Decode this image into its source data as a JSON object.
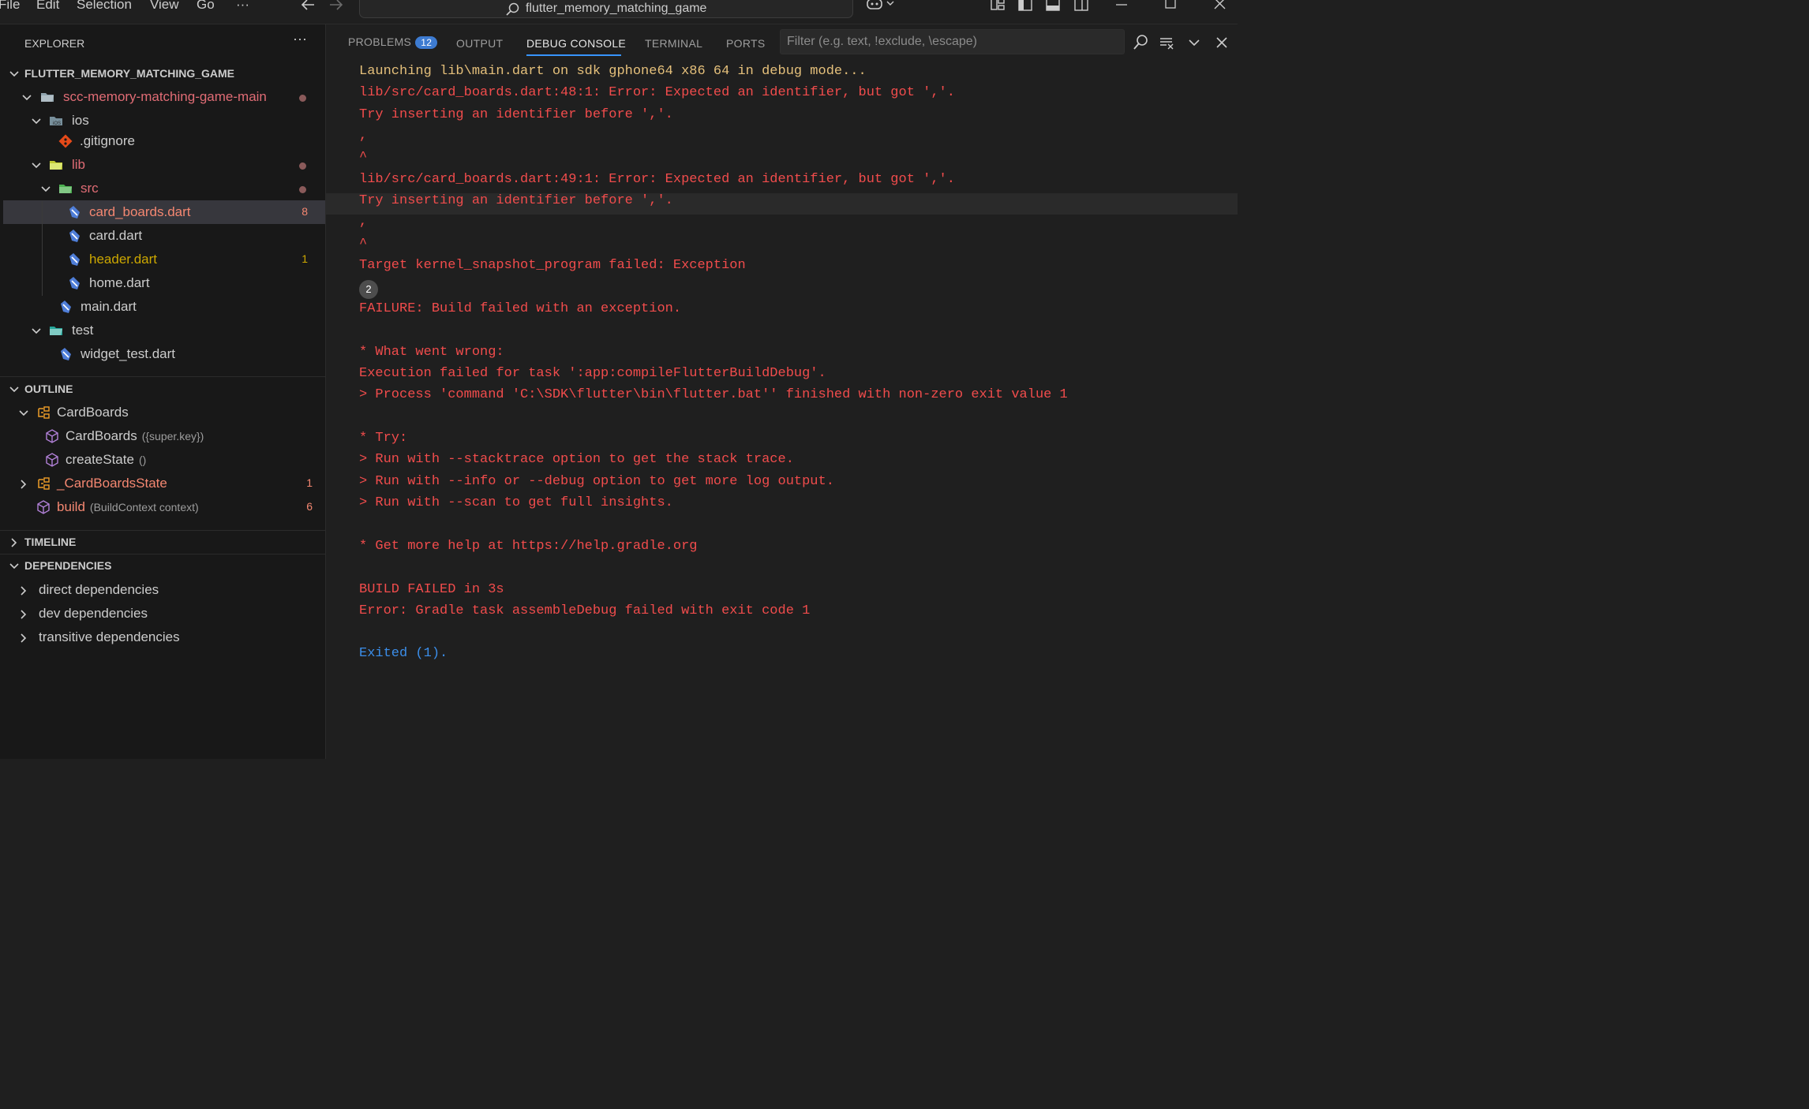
{
  "menu": {
    "file": "File",
    "edit": "Edit",
    "selection": "Selection",
    "view": "View",
    "go": "Go",
    "more": "···"
  },
  "command_center": {
    "title": "flutter_memory_matching_game"
  },
  "explorer": {
    "title": "EXPLORER",
    "more": "···",
    "project": "FLUTTER_MEMORY_MATCHING_GAME",
    "tree": [
      {
        "label": "scc-memory-matching-game-main",
        "color": "#e06c75",
        "dot": true
      },
      {
        "label": "ios",
        "color": "#cccccc"
      },
      {
        "label": ".gitignore",
        "color": "#cccccc"
      },
      {
        "label": "lib",
        "color": "#e06c75",
        "dot": true
      },
      {
        "label": "src",
        "color": "#e06c75",
        "dot": true
      },
      {
        "label": "card_boards.dart",
        "color": "#f48771",
        "badge": "8",
        "badge_color": "#f48771"
      },
      {
        "label": "card.dart",
        "color": "#cccccc"
      },
      {
        "label": "header.dart",
        "color": "#cca700",
        "badge": "1",
        "badge_color": "#cca700"
      },
      {
        "label": "home.dart",
        "color": "#cccccc"
      },
      {
        "label": "main.dart",
        "color": "#cccccc"
      },
      {
        "label": "test",
        "color": "#cccccc"
      },
      {
        "label": "widget_test.dart",
        "color": "#cccccc"
      }
    ]
  },
  "outline": {
    "title": "OUTLINE",
    "items": [
      {
        "label": "CardBoards",
        "hint": "",
        "color": "#cccccc"
      },
      {
        "label": "CardBoards",
        "hint": "({super.key})",
        "color": "#cccccc"
      },
      {
        "label": "createState",
        "hint": "()",
        "color": "#cccccc"
      },
      {
        "label": "_CardBoardsState",
        "hint": "",
        "color": "#f48771",
        "badge": "1"
      },
      {
        "label": "build",
        "hint": "(BuildContext context)",
        "color": "#f48771",
        "badge": "6"
      }
    ]
  },
  "timeline": {
    "title": "TIMELINE"
  },
  "dependencies": {
    "title": "DEPENDENCIES",
    "items": [
      "direct dependencies",
      "dev dependencies",
      "transitive dependencies"
    ]
  },
  "panel": {
    "tabs": {
      "problems": "PROBLEMS",
      "problem_count": "12",
      "output": "OUTPUT",
      "debug_console": "DEBUG CONSOLE",
      "terminal": "TERMINAL",
      "ports": "PORTS"
    },
    "filter_placeholder": "Filter (e.g. text, !exclude, \\escape)"
  },
  "console": {
    "repeat_count": "2",
    "lines": [
      {
        "text": "Launching lib\\main.dart on sdk gphone64 x86 64 in debug mode...",
        "kind": "warn"
      },
      {
        "text": "lib/src/card_boards.dart:48:1: Error: Expected an identifier, but got ','.",
        "kind": "err"
      },
      {
        "text": "Try inserting an identifier before ','.",
        "kind": "err"
      },
      {
        "text": ",",
        "kind": "err"
      },
      {
        "text": "^",
        "kind": "err"
      },
      {
        "text": "lib/src/card_boards.dart:49:1: Error: Expected an identifier, but got ','.",
        "kind": "err"
      },
      {
        "text": "Try inserting an identifier before ','.",
        "kind": "err"
      },
      {
        "text": ",",
        "kind": "err"
      },
      {
        "text": "^",
        "kind": "err"
      },
      {
        "text": "Target kernel_snapshot_program failed: Exception",
        "kind": "err"
      },
      {
        "text": "FAILURE: Build failed with an exception.",
        "kind": "err"
      },
      {
        "text": "* What went wrong:",
        "kind": "err"
      },
      {
        "text": "Execution failed for task ':app:compileFlutterBuildDebug'.",
        "kind": "err"
      },
      {
        "text": "> Process 'command 'C:\\SDK\\flutter\\bin\\flutter.bat'' finished with non-zero exit value 1",
        "kind": "err"
      },
      {
        "text": "* Try:",
        "kind": "err"
      },
      {
        "text": "> Run with --stacktrace option to get the stack trace.",
        "kind": "err"
      },
      {
        "text": "> Run with --info or --debug option to get more log output.",
        "kind": "err"
      },
      {
        "text": "> Run with --scan to get full insights.",
        "kind": "err"
      },
      {
        "text": "* Get more help at https://help.gradle.org",
        "kind": "err"
      },
      {
        "text": "BUILD FAILED in 3s",
        "kind": "err"
      },
      {
        "text": "Error: Gradle task assembleDebug failed with exit code 1",
        "kind": "err"
      },
      {
        "text": "Exited (1).",
        "kind": "info"
      }
    ]
  }
}
